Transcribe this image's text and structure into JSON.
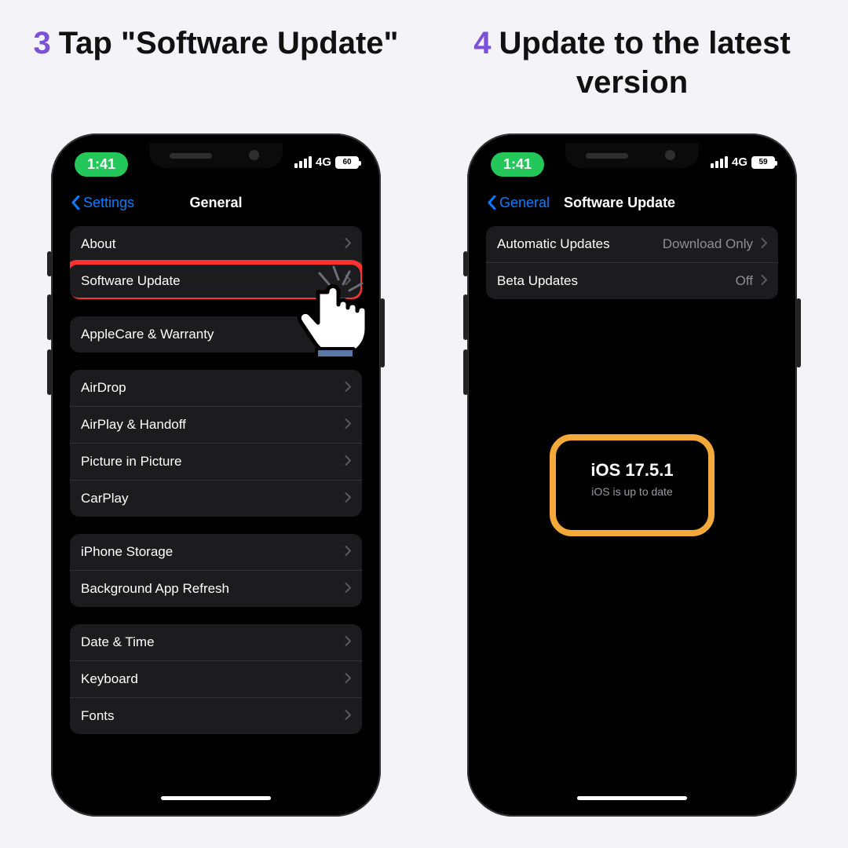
{
  "steps": {
    "left": {
      "num": "3",
      "text": "Tap \"Software Update\""
    },
    "right": {
      "num": "4",
      "text": "Update to the latest version"
    }
  },
  "phoneA": {
    "time": "1:41",
    "network": "4G",
    "battery": "60",
    "nav": {
      "back": "Settings",
      "title": "General"
    },
    "groups": [
      [
        {
          "label": "About",
          "highlight": false
        },
        {
          "label": "Software Update",
          "highlight": true
        }
      ],
      [
        {
          "label": "AppleCare & Warranty"
        }
      ],
      [
        {
          "label": "AirDrop"
        },
        {
          "label": "AirPlay & Handoff"
        },
        {
          "label": "Picture in Picture"
        },
        {
          "label": "CarPlay"
        }
      ],
      [
        {
          "label": "iPhone Storage"
        },
        {
          "label": "Background App Refresh"
        }
      ],
      [
        {
          "label": "Date & Time"
        },
        {
          "label": "Keyboard"
        },
        {
          "label": "Fonts"
        }
      ]
    ]
  },
  "phoneB": {
    "time": "1:41",
    "network": "4G",
    "battery": "59",
    "nav": {
      "back": "General",
      "title": "Software Update"
    },
    "rows": [
      {
        "label": "Automatic Updates",
        "value": "Download Only"
      },
      {
        "label": "Beta Updates",
        "value": "Off"
      }
    ],
    "status": {
      "version": "iOS 17.5.1",
      "msg": "iOS is up to date"
    }
  },
  "colors": {
    "highlight": "#ff3131",
    "orange": "#f4a93b",
    "accent": "#7b52d6"
  }
}
